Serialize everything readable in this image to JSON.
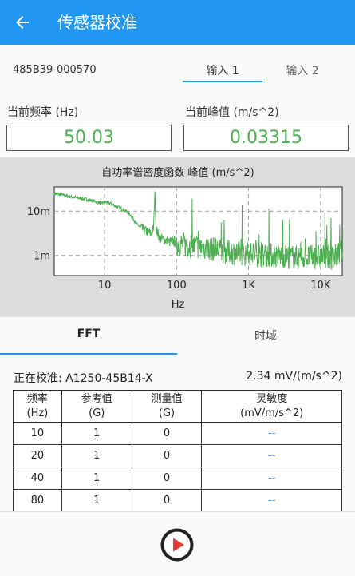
{
  "appbar": {
    "title": "传感器校准",
    "back_icon": "arrow-back-icon"
  },
  "device": {
    "id": "485B39-000570"
  },
  "input_tabs": [
    {
      "label": "输入 1",
      "active": true
    },
    {
      "label": "输入 2",
      "active": false
    }
  ],
  "readings": {
    "freq_label": "当前频率 (Hz)",
    "freq_value": "50.03",
    "peak_label": "当前峰值 (m/s^2)",
    "peak_value": "0.03315"
  },
  "chart_data": {
    "type": "line",
    "title": "自功率谱密度函数 峰值 (m/s^2)",
    "xlabel": "Hz",
    "x_scale": "log",
    "y_scale": "log",
    "xlim": [
      2,
      20000
    ],
    "ylim": [
      0.00035,
      0.035
    ],
    "x_tick_labels": [
      "10",
      "100",
      "1K",
      "10K"
    ],
    "y_tick_labels": [
      "10m",
      "1m"
    ],
    "grid": true,
    "series": [
      {
        "color": "#4caf50",
        "x": [
          2,
          3,
          4,
          5,
          6,
          7,
          8,
          9,
          10,
          12,
          14,
          16,
          18,
          20,
          24,
          28,
          32,
          36,
          40,
          44,
          48,
          50,
          52,
          56,
          60,
          70,
          80,
          90,
          100,
          120,
          150,
          200,
          250,
          300,
          400,
          500,
          700,
          1000,
          1500,
          2000,
          3000,
          5000,
          7000,
          10000,
          15000,
          20000
        ],
        "y": [
          0.025,
          0.022,
          0.02,
          0.019,
          0.018,
          0.017,
          0.016,
          0.015,
          0.016,
          0.015,
          0.013,
          0.012,
          0.011,
          0.01,
          0.0075,
          0.005,
          0.0042,
          0.0036,
          0.0034,
          0.003,
          0.004,
          0.028,
          0.004,
          0.0028,
          0.0024,
          0.0022,
          0.002,
          0.0021,
          0.0019,
          0.0018,
          0.0017,
          0.0016,
          0.0015,
          0.0014,
          0.0013,
          0.0012,
          0.0011,
          0.0011,
          0.001,
          0.001,
          0.00095,
          0.0009,
          0.0009,
          0.00095,
          0.0009,
          0.0012
        ]
      }
    ]
  },
  "mode_tabs": [
    {
      "label": "FFT",
      "active": true
    },
    {
      "label": "时域",
      "active": false
    }
  ],
  "calibration": {
    "label": "正在校准: A1250-45B14-X",
    "sensitivity": "2.34 mV/(m/s^2)"
  },
  "table": {
    "headers": [
      {
        "l1": "频率",
        "l2": "(Hz)"
      },
      {
        "l1": "参考值",
        "l2": "(G)"
      },
      {
        "l1": "测量值",
        "l2": "(G)"
      },
      {
        "l1": "灵敏度",
        "l2": "(mV/m/s^2)"
      }
    ],
    "rows": [
      [
        "10",
        "1",
        "0",
        "--"
      ],
      [
        "20",
        "1",
        "0",
        "--"
      ],
      [
        "40",
        "1",
        "0",
        "--"
      ],
      [
        "80",
        "1",
        "0",
        "--"
      ]
    ]
  },
  "controls": {
    "play_icon": "play-icon"
  }
}
